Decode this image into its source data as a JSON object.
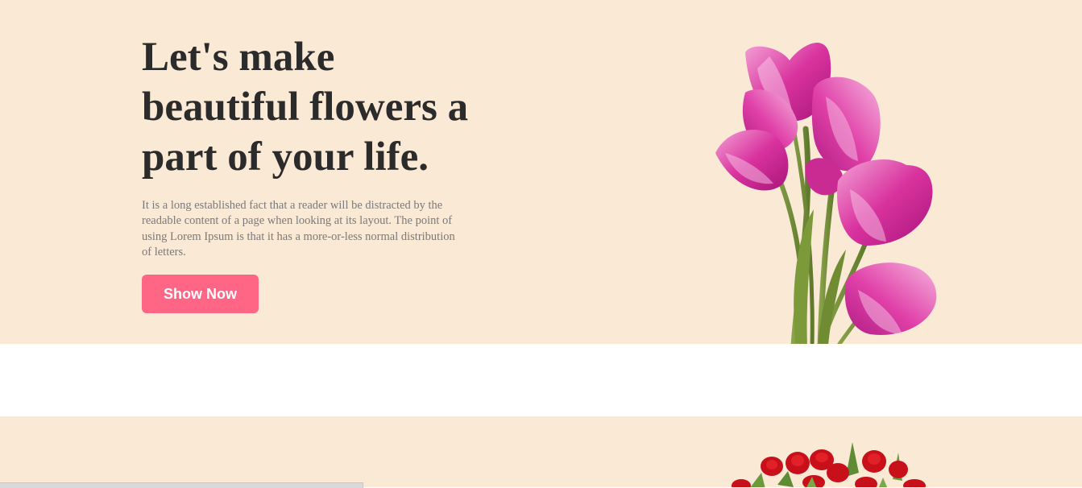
{
  "hero": {
    "title_lines": [
      "Let's make",
      "beautiful flowers a",
      "part of your life."
    ],
    "description_lines": [
      "It is a long established fact that a reader will be distracted by the",
      "readable content of a page when looking at its layout. The point of",
      "using Lorem Ipsum is that it has a more-or-less normal distribution",
      "of letters."
    ],
    "button_label": "Show Now",
    "image": "pink-tulips-bouquet"
  },
  "section2": {
    "image": "red-roses-bouquet"
  },
  "colors": {
    "background": "#fae9d5",
    "accent": "#ff6584",
    "title": "#2b2b2b",
    "body_text": "#7a7a7a"
  }
}
